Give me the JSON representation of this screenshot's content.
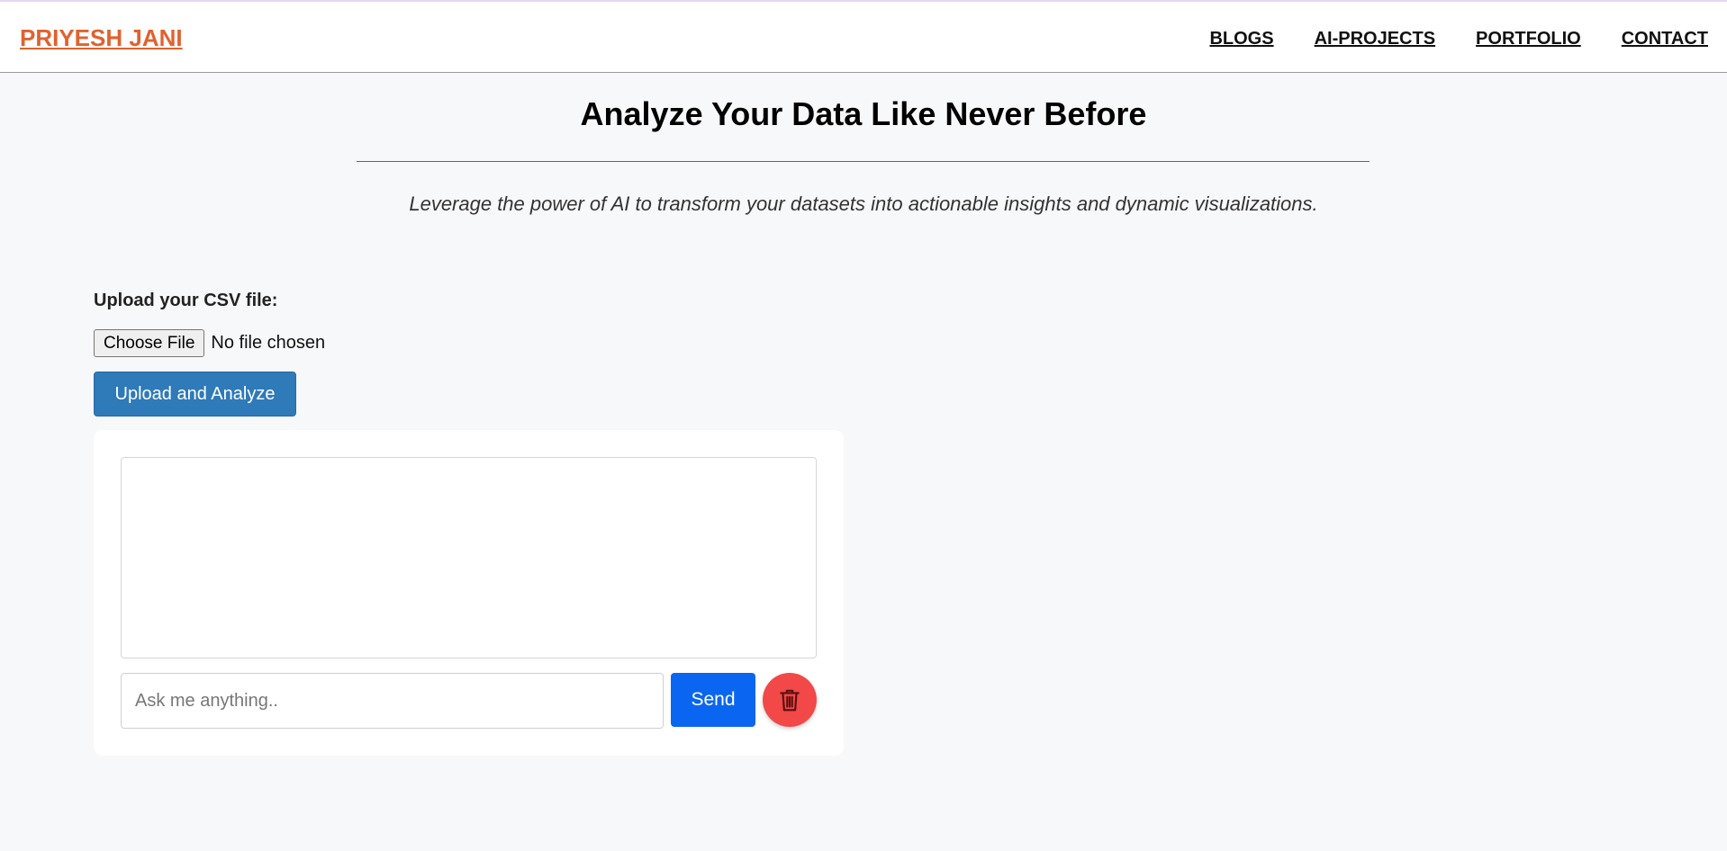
{
  "header": {
    "brand": "PRIYESH JANI",
    "nav": [
      {
        "label": "BLOGS"
      },
      {
        "label": "AI-PROJECTS"
      },
      {
        "label": "PORTFOLIO"
      },
      {
        "label": "CONTACT"
      }
    ]
  },
  "hero": {
    "title": "Analyze Your Data Like Never Before",
    "subtitle": "Leverage the power of AI to transform your datasets into actionable insights and dynamic visualizations."
  },
  "upload": {
    "label": "Upload your CSV file:",
    "choose_file": "Choose File",
    "file_status": "No file chosen",
    "submit": "Upload and Analyze"
  },
  "chat": {
    "input_placeholder": "Ask me anything..",
    "send": "Send",
    "clear_icon": "trash-icon"
  },
  "colors": {
    "brand": "#e0622f",
    "upload_button": "#2f7ab8",
    "send_button": "#0a66f0",
    "clear_button": "#f24848",
    "page_background": "#f7f8fa"
  }
}
